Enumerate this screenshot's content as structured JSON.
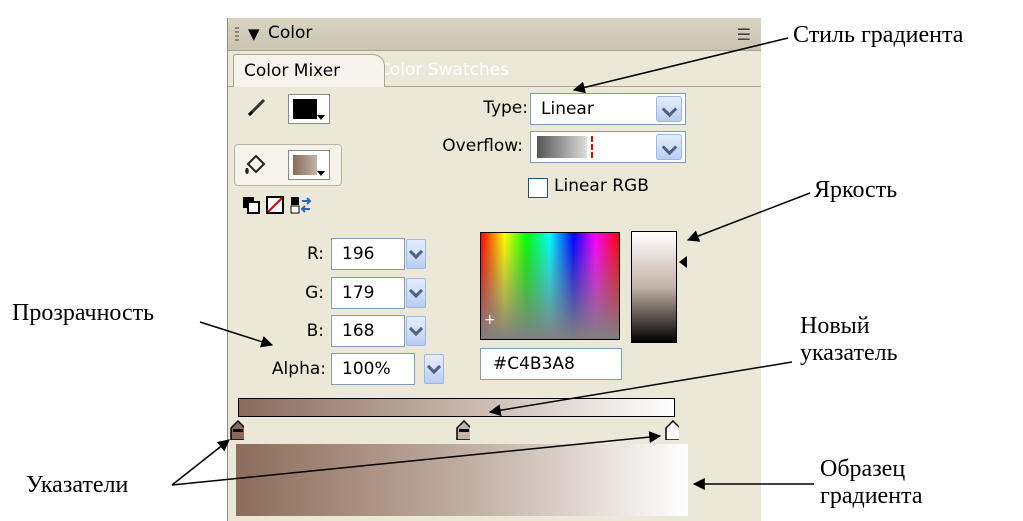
{
  "panel": {
    "title": "Color",
    "tabs": [
      {
        "label": "Color Mixer",
        "active": true
      },
      {
        "label": "Color Swatches",
        "active": false
      }
    ],
    "type": {
      "label": "Type:",
      "value": "Linear"
    },
    "overflow": {
      "label": "Overflow:"
    },
    "linear_rgb": {
      "label": "Linear RGB",
      "checked": false
    },
    "rgb": [
      {
        "label": "R:",
        "value": "196"
      },
      {
        "label": "G:",
        "value": "179"
      },
      {
        "label": "B:",
        "value": "168"
      }
    ],
    "alpha": {
      "label": "Alpha:",
      "value": "100%"
    },
    "hex": "#C4B3A8"
  },
  "annotations": {
    "gradient_style": "Стиль градиента",
    "brightness": "Яркость",
    "transparency": "Прозрачность",
    "new_pointer_line1": "Новый",
    "new_pointer_line2": "указатель",
    "pointers": "Указатели",
    "gradient_sample_line1": "Образец",
    "gradient_sample_line2": "градиента"
  },
  "colors": {
    "panel_bg": "#ece8d8",
    "stroke_swatch": "#000000",
    "fill_swatch_from": "#8a6b5a",
    "fill_swatch_to": "#c4b3a8",
    "dropdown_accent": "#b9cdf2"
  }
}
